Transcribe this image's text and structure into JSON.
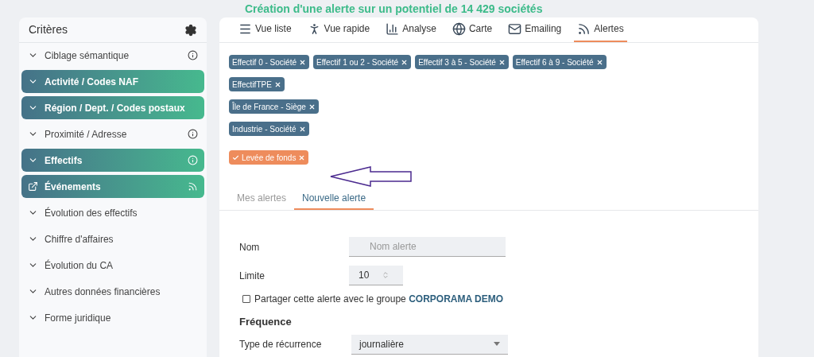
{
  "title": "Création d'une alerte sur un potentiel de 14 429 sociétés",
  "sidebar": {
    "title": "Critères",
    "items": [
      {
        "label": "Ciblage sémantique",
        "highlighted": false,
        "kind": "section",
        "info": true
      },
      {
        "label": "Activité / Codes NAF",
        "highlighted": true,
        "kind": "section",
        "info": false
      },
      {
        "label": "Région / Dept. / Codes postaux",
        "highlighted": true,
        "kind": "section",
        "info": false
      },
      {
        "label": "Proximité / Adresse",
        "highlighted": false,
        "kind": "section",
        "info": true
      },
      {
        "label": "Effectifs",
        "highlighted": true,
        "kind": "section",
        "info": true
      },
      {
        "label": "Événements",
        "highlighted": true,
        "kind": "link",
        "info": false
      },
      {
        "label": "Évolution des effectifs",
        "highlighted": false,
        "kind": "section",
        "info": false
      },
      {
        "label": "Chiffre d'affaires",
        "highlighted": false,
        "kind": "section",
        "info": false
      },
      {
        "label": "Évolution du CA",
        "highlighted": false,
        "kind": "section",
        "info": false
      },
      {
        "label": "Autres données financières",
        "highlighted": false,
        "kind": "section",
        "info": false
      },
      {
        "label": "Forme juridique",
        "highlighted": false,
        "kind": "section",
        "info": false
      }
    ]
  },
  "tabs": [
    {
      "label": "Vue liste",
      "selected": false
    },
    {
      "label": "Vue rapide",
      "selected": false
    },
    {
      "label": "Analyse",
      "selected": false
    },
    {
      "label": "Carte",
      "selected": false
    },
    {
      "label": "Emailing",
      "selected": false
    },
    {
      "label": "Alertes",
      "selected": true
    }
  ],
  "tag_rows": [
    [
      {
        "label": "Effectif 0 - Société",
        "kind": "criterion",
        "checked": false
      },
      {
        "label": "Effectif 1 ou 2 - Société",
        "kind": "criterion",
        "checked": false
      },
      {
        "label": "Effectif 3 à 5 - Société",
        "kind": "criterion",
        "checked": false
      },
      {
        "label": "Effectif 6 à 9 - Société",
        "kind": "criterion",
        "checked": false
      }
    ],
    [
      {
        "label": "EffectifTPE",
        "kind": "criterion",
        "checked": false
      }
    ],
    [
      {
        "label": "Île de France - Siège",
        "kind": "criterion",
        "checked": false
      }
    ],
    [
      {
        "label": "Industrie - Société",
        "kind": "criterion",
        "checked": false
      }
    ],
    [
      {
        "label": "Levée de fonds",
        "kind": "event",
        "checked": true
      }
    ]
  ],
  "alert_tabs": [
    {
      "label": "Mes alertes",
      "selected": false
    },
    {
      "label": "Nouvelle alerte",
      "selected": true
    }
  ],
  "form": {
    "name": {
      "label": "Nom",
      "placeholder": "Nom alerte"
    },
    "limit": {
      "label": "Limite",
      "value": "10"
    },
    "share": {
      "label": "Partager cette alerte avec le groupe **CORPORAMA DEMO**",
      "checked": false
    },
    "frequency_heading": "Fréquence",
    "recurrence": {
      "label": "Type de récurrence",
      "value": "journalière"
    }
  }
}
